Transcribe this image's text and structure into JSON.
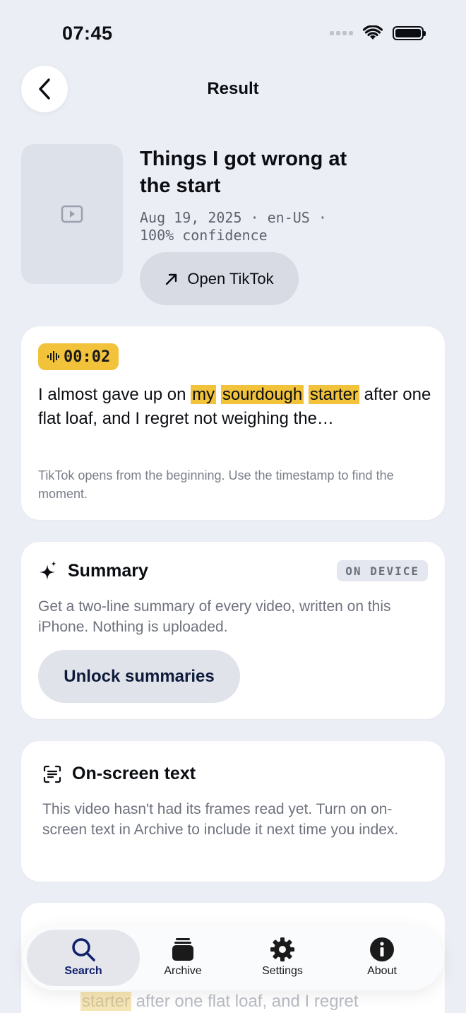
{
  "status": {
    "time": "07:45"
  },
  "header": {
    "title": "Result"
  },
  "video": {
    "title": "Things I got wrong at the start",
    "meta": "Aug 19, 2025 · en-US · 100% confidence",
    "open_label": "Open TikTok"
  },
  "match": {
    "timestamp": "00:02",
    "text_before": "I almost gave up on ",
    "hl1": "my",
    "hl2": "sourdough",
    "hl3": "starter",
    "text_after": " after one flat loaf, and I regret not weighing the…",
    "note": "TikTok opens from the beginning. Use the timestamp to find the moment."
  },
  "summary": {
    "title": "Summary",
    "badge": "ON DEVICE",
    "body": "Get a two-line summary of every video, written on this iPhone. Nothing is uploaded.",
    "button": "Unlock summaries"
  },
  "onscreen": {
    "title": "On-screen text",
    "body": "This video hasn't had its frames read yet. Turn on on-screen text in Archive to include it next time you index."
  },
  "ghost_card": {
    "hl": "starter",
    "rest": " after one flat loaf, and I regret"
  },
  "tabs": [
    {
      "label": "Search",
      "icon": "search-icon",
      "active": true
    },
    {
      "label": "Archive",
      "icon": "archive-icon",
      "active": false
    },
    {
      "label": "Settings",
      "icon": "gear-icon",
      "active": false
    },
    {
      "label": "About",
      "icon": "info-icon",
      "active": false
    }
  ],
  "colors": {
    "highlight": "#f2c33a",
    "accent": "#10206a",
    "background": "#eceef5"
  }
}
